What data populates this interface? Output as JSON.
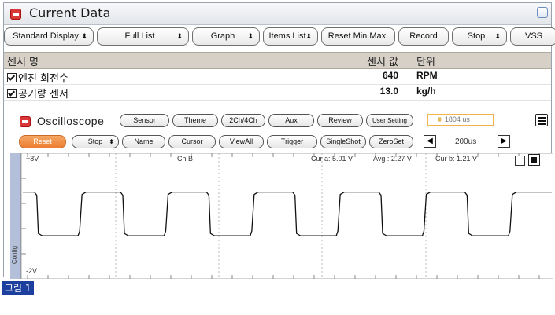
{
  "window": {
    "title": "Current Data"
  },
  "toolbar": [
    {
      "name": "standard-display-select",
      "label": "Standard Display",
      "arrow": "⬍",
      "x": 0,
      "w": 114
    },
    {
      "name": "full-list-select",
      "label": "Full List",
      "arrow": "⬍",
      "x": 118,
      "w": 117
    },
    {
      "name": "graph-select",
      "label": "Graph",
      "arrow": "⬍",
      "x": 239,
      "w": 86
    },
    {
      "name": "items-list-select",
      "label": "Items List",
      "arrow": "⬍",
      "x": 329,
      "w": 70
    },
    {
      "name": "reset-min-max-button",
      "label": "Reset Min.Max.",
      "arrow": "",
      "x": 403,
      "w": 94
    },
    {
      "name": "record-button",
      "label": "Record",
      "arrow": "",
      "x": 501,
      "w": 64
    },
    {
      "name": "stop-select",
      "label": "Stop",
      "arrow": "⬍",
      "x": 569,
      "w": 70
    },
    {
      "name": "vss-button",
      "label": "VSS",
      "arrow": "",
      "x": 643,
      "w": 60
    }
  ],
  "table": {
    "headers": {
      "name": "센서 명",
      "value": "센서 값",
      "unit": "단위"
    },
    "rows": [
      {
        "name": "엔진 회전수",
        "value": "640",
        "unit": "RPM"
      },
      {
        "name": "공기량 센서",
        "value": "13.0",
        "unit": "kg/h"
      }
    ]
  },
  "oscilloscope": {
    "title": "Oscilloscope",
    "top_buttons": [
      "Sensor",
      "Theme",
      "2Ch/4Ch",
      "Aux",
      "Review",
      "User Setting"
    ],
    "freq_display": "1804 us",
    "second_buttons": [
      "Reset",
      "Stop",
      "Name",
      "Cursor",
      "ViewAll",
      "Trigger",
      "SingleShot",
      "ZeroSet"
    ],
    "stop_arrow": "⬍",
    "timebase": "200us",
    "channel": "Ch B",
    "cursor_a": "Cur a: 5.01 V",
    "avg": "Avg : 2.27 V",
    "cursor_b": "Cur b: 1.21 V",
    "y_max": "+8V",
    "y_min": "-2V",
    "config_tab": "Config"
  },
  "caption": "그림 1",
  "colors": {
    "accent_orange": "#ec7d31",
    "icon_red": "#d9383a",
    "caption_bg": "#1d3f9d"
  },
  "chart_data": {
    "type": "line",
    "series_shape": "square wave",
    "ylim": [
      -2,
      8
    ],
    "y_high": 5.01,
    "y_low": 1.21,
    "cycles": 6
  }
}
